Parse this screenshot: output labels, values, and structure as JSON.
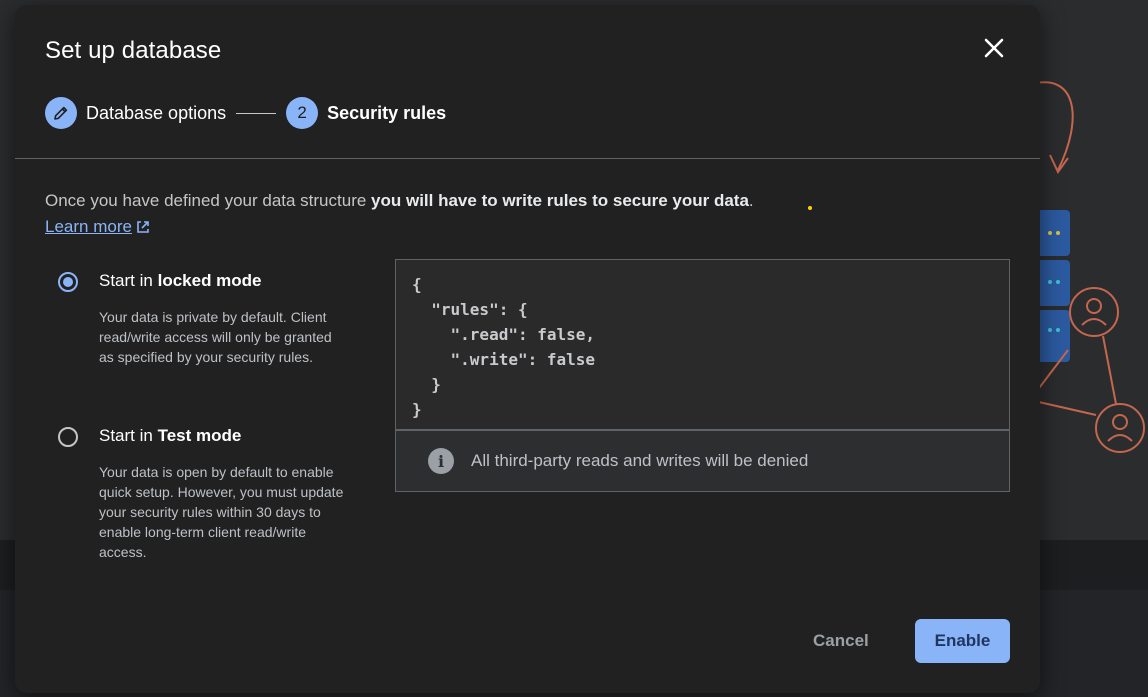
{
  "dialog": {
    "title": "Set up database",
    "close_icon": "close-icon"
  },
  "stepper": {
    "steps": [
      {
        "label": "Database options",
        "icon": "pencil-icon",
        "state": "completed"
      },
      {
        "number": "2",
        "label": "Security rules",
        "state": "active"
      }
    ]
  },
  "intro": {
    "text_plain": "Once you have defined your data structure ",
    "text_bold": "you will have to write rules to secure your data",
    "text_end": ".",
    "learn_more": "Learn more",
    "learn_more_icon": "external-link-icon"
  },
  "options": [
    {
      "prefix": "Start in ",
      "mode": "locked mode",
      "selected": true,
      "description": "Your data is private by default. Client read/write access will only be granted as specified by your security rules."
    },
    {
      "prefix": "Start in ",
      "mode": "Test mode",
      "selected": false,
      "description": "Your data is open by default to enable quick setup. However, you must update your security rules within 30 days to enable long-term client read/write access."
    }
  ],
  "rules_code": "{\n  \"rules\": {\n    \".read\": false,\n    \".write\": false\n  }\n}",
  "info": {
    "icon": "info-icon",
    "text": "All third-party reads and writes will be denied"
  },
  "footer": {
    "cancel": "Cancel",
    "enable": "Enable"
  },
  "colors": {
    "accent": "#8ab4f8",
    "dialog_bg": "#212121",
    "illustration": "#c5664e",
    "server_blue": "#2c5aa0"
  }
}
